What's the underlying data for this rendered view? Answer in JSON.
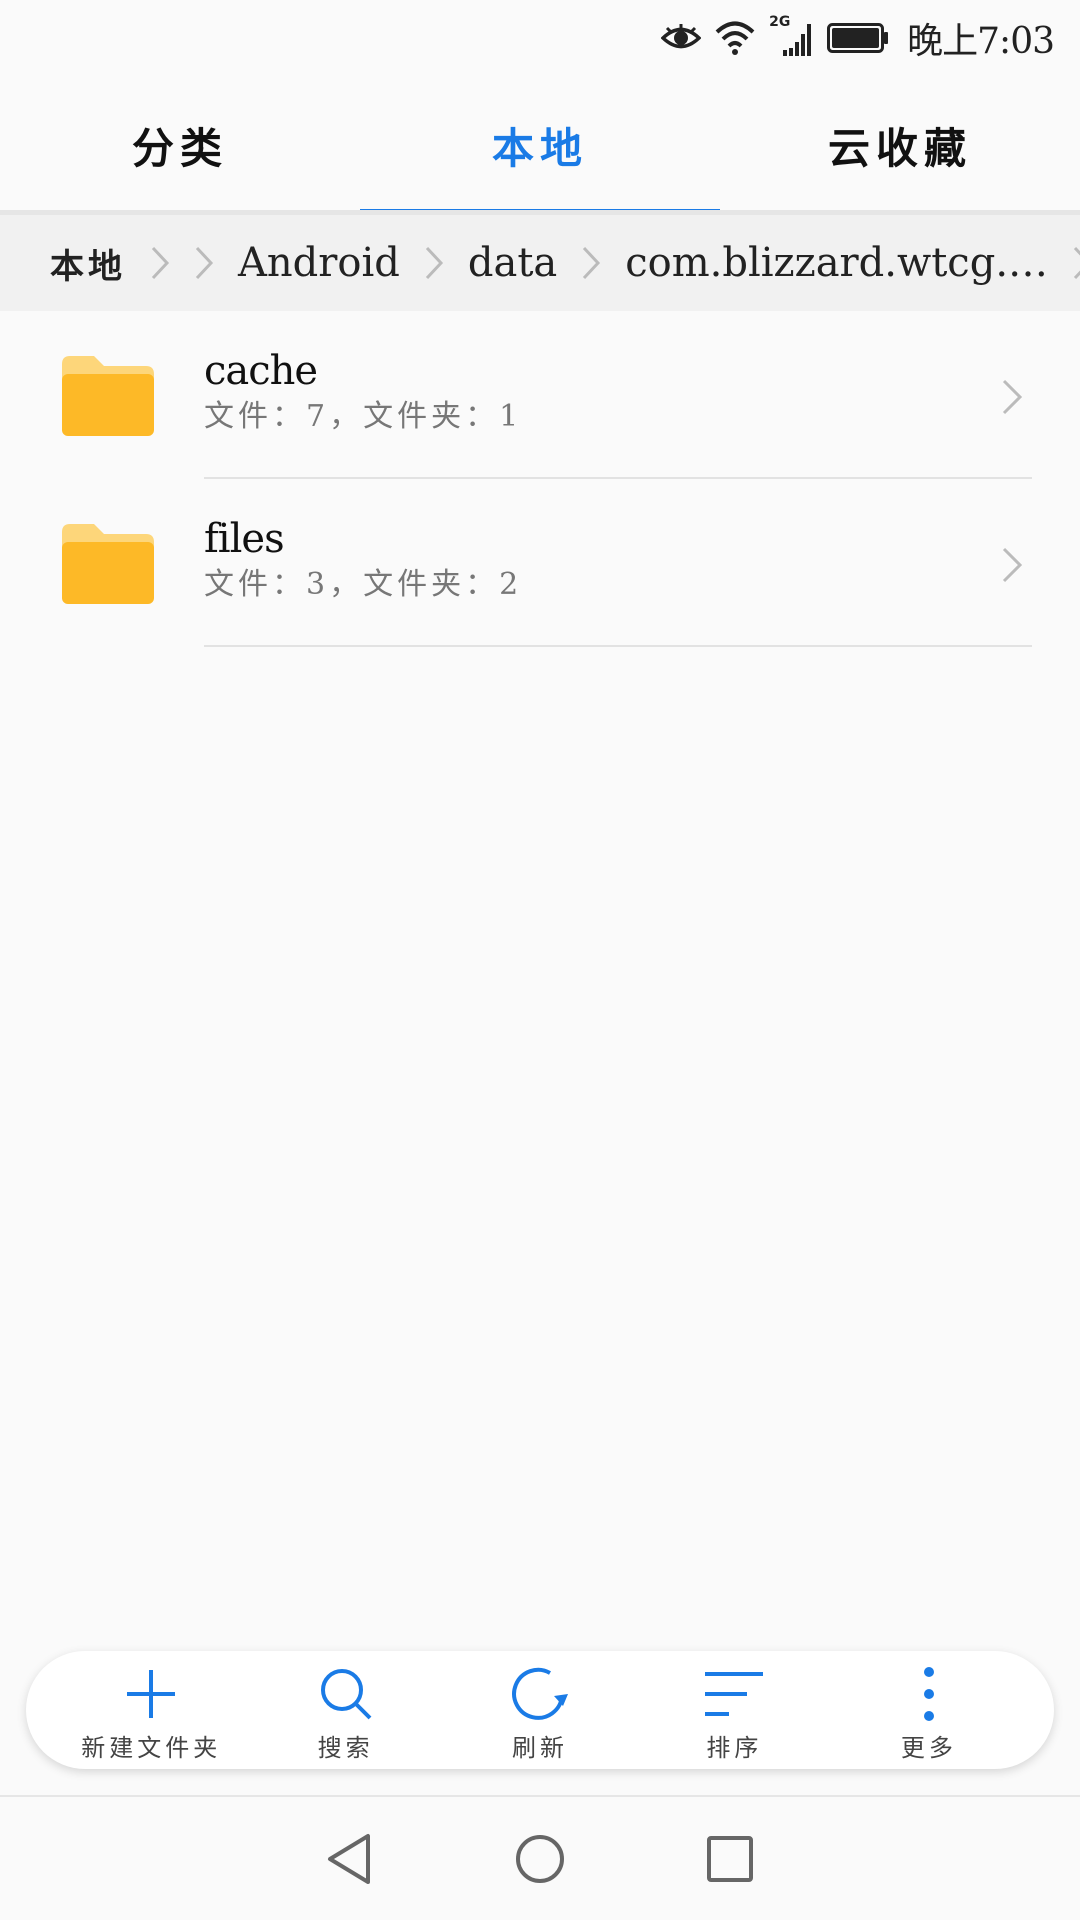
{
  "status_bar": {
    "network": "2G",
    "time": "晚上7:03"
  },
  "tabs": [
    {
      "label": "分类",
      "active": false
    },
    {
      "label": "本地",
      "active": true
    },
    {
      "label": "云收藏",
      "active": false
    }
  ],
  "breadcrumb": {
    "items": [
      "本地",
      "",
      "Android",
      "data",
      "com.blizzard.wtcg.…"
    ]
  },
  "files": [
    {
      "name": "cache",
      "meta": "文件：7，文件夹：1"
    },
    {
      "name": "files",
      "meta": "文件：3，文件夹：2"
    }
  ],
  "toolbar": {
    "new_folder": "新建文件夹",
    "search": "搜索",
    "refresh": "刷新",
    "sort": "排序",
    "more": "更多"
  },
  "colors": {
    "accent": "#1a7be6",
    "folder": "#fdb927",
    "folder_tab": "#fdd67a"
  }
}
